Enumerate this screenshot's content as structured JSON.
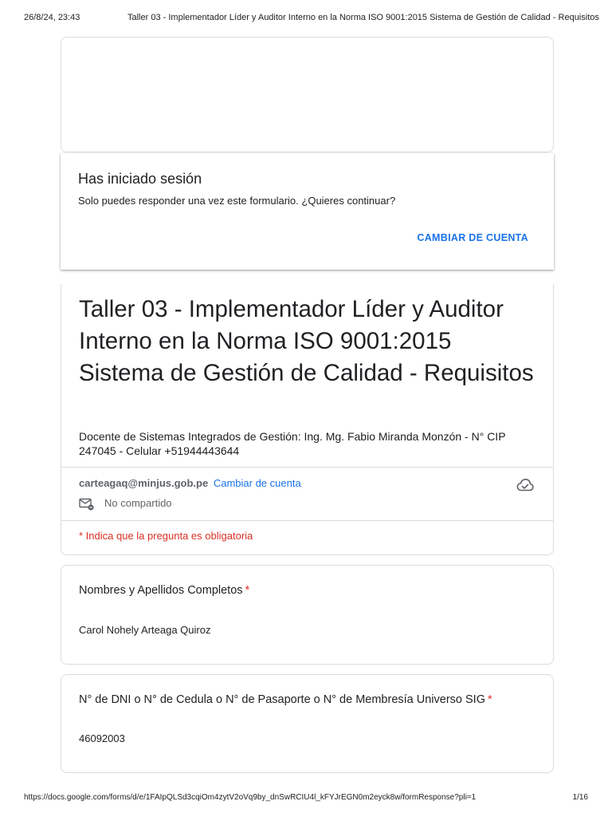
{
  "print_header": {
    "datetime": "26/8/24, 23:43",
    "title": "Taller 03 - Implementador Líder y Auditor Interno en la Norma ISO 9001:2015 Sistema de Gestión de Calidad - Requisitos"
  },
  "signed_in": {
    "heading": "Has iniciado sesión",
    "message": "Solo puedes responder una vez este formulario. ¿Quieres continuar?",
    "switch_account": "CAMBIAR DE CUENTA"
  },
  "form": {
    "title": "Taller 03 - Implementador Líder y Auditor Interno en la Norma ISO 9001:2015 Sistema de Gestión de Calidad - Requisitos",
    "description": "Docente de Sistemas Integrados de Gestión: Ing. Mg. Fabio Miranda Monzón - N° CIP 247045 - Celular +51944443644",
    "account_email": "carteagaq@minjus.gob.pe",
    "change_account": "Cambiar de cuenta",
    "not_shared": "No compartido",
    "required_note": "* Indica que la pregunta es obligatoria"
  },
  "questions": [
    {
      "label": "Nombres y Apellidos Completos",
      "required_mark": "*",
      "answer": "Carol Nohely Arteaga Quiroz"
    },
    {
      "label": "N° de DNI o N° de Cedula o N° de Pasaporte o N° de Membresía Universo SIG",
      "required_mark": "*",
      "answer": "46092003"
    }
  ],
  "print_footer": {
    "url": "https://docs.google.com/forms/d/e/1FAIpQLSd3cqiOm4zytV2oVq9by_dnSwRCIU4l_kFYJrEGN0m2eyck8w/formResponse?pli=1",
    "page": "1/16"
  },
  "icons": {
    "cloud": "cloud-done-icon",
    "mail": "mail-lock-icon"
  },
  "colors": {
    "accent": "#1a73e8",
    "required": "#d93025",
    "border": "#dadce0",
    "muted": "#5f6368"
  }
}
